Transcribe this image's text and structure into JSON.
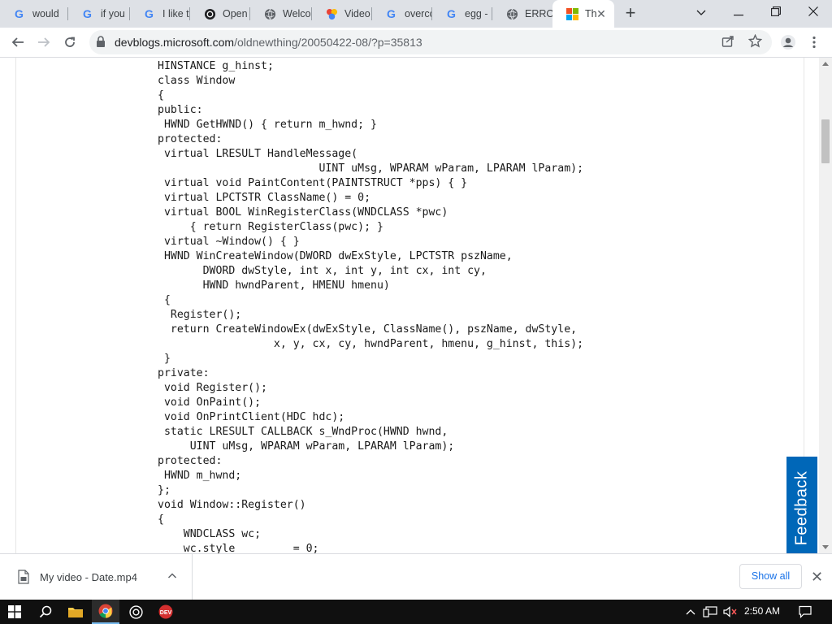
{
  "browser": {
    "tabs": [
      {
        "label": "would",
        "icon": "google-icon"
      },
      {
        "label": "if you",
        "icon": "google-icon"
      },
      {
        "label": "I like t",
        "icon": "google-icon"
      },
      {
        "label": "Open",
        "icon": "openai-icon"
      },
      {
        "label": "Welco",
        "icon": "globe-icon"
      },
      {
        "label": "Video",
        "icon": "colorful-app-icon"
      },
      {
        "label": "overcc",
        "icon": "google-icon"
      },
      {
        "label": "egg -",
        "icon": "google-icon"
      },
      {
        "label": "ERROR",
        "icon": "globe-icon"
      },
      {
        "label": "Th",
        "icon": "microsoft-icon",
        "active": true
      }
    ],
    "new_tab": "+",
    "window_controls": {
      "dropdown": "⌄",
      "minimize": "—",
      "restore": "❐",
      "close": "✕"
    },
    "url_host": "devblogs.microsoft.com",
    "url_path": "/oldnewthing/20050422-08/?p=35813"
  },
  "article": {
    "code_lines": [
      "HINSTANCE g_hinst;",
      "class Window",
      "{",
      "public:",
      " HWND GetHWND() { return m_hwnd; }",
      "protected:",
      " virtual LRESULT HandleMessage(",
      "                         UINT uMsg, WPARAM wParam, LPARAM lParam);",
      " virtual void PaintContent(PAINTSTRUCT *pps) { }",
      " virtual LPCTSTR ClassName() = 0;",
      " virtual BOOL WinRegisterClass(WNDCLASS *pwc)",
      "     { return RegisterClass(pwc); }",
      " virtual ~Window() { }",
      " HWND WinCreateWindow(DWORD dwExStyle, LPCTSTR pszName,",
      "       DWORD dwStyle, int x, int y, int cx, int cy,",
      "       HWND hwndParent, HMENU hmenu)",
      " {",
      "  Register();",
      "  return CreateWindowEx(dwExStyle, ClassName(), pszName, dwStyle,",
      "                  x, y, cx, cy, hwndParent, hmenu, g_hinst, this);",
      " }",
      "private:",
      " void Register();",
      " void OnPaint();",
      " void OnPrintClient(HDC hdc);",
      " static LRESULT CALLBACK s_WndProc(HWND hwnd,",
      "     UINT uMsg, WPARAM wParam, LPARAM lParam);",
      "protected:",
      " HWND m_hwnd;",
      "};",
      "void Window::Register()",
      "{",
      "    WNDCLASS wc;",
      "    wc.style         = 0;"
    ],
    "feedback_label": "Feedback"
  },
  "downloads": {
    "file_name": "My video - Date.mp4",
    "show_all": "Show all"
  },
  "taskbar": {
    "time": "2:50 AM"
  },
  "colors": {
    "accent_blue": "#0067b8",
    "link_blue": "#1a73e8",
    "taskbar": "#101010",
    "tab_strip": "#dee1e6"
  }
}
